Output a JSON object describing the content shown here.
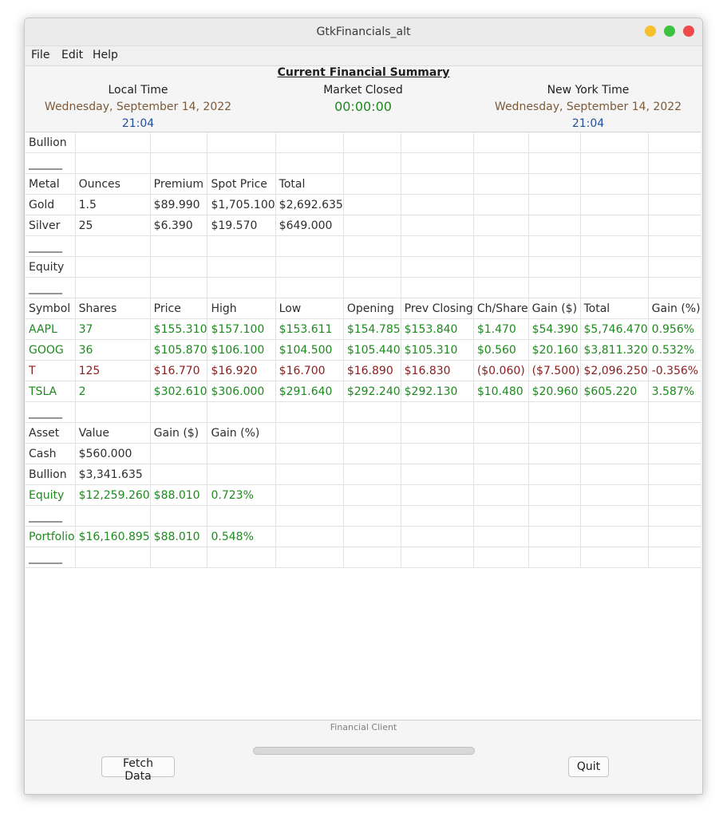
{
  "window": {
    "title": "GtkFinancials_alt"
  },
  "menu": {
    "file": "File",
    "edit": "Edit",
    "help": "Help"
  },
  "summary": {
    "title": "Current Financial Summary",
    "local": {
      "label": "Local Time",
      "date": "Wednesday, September 14, 2022",
      "time": "21:04"
    },
    "market": {
      "label": "Market Closed",
      "countdown": "00:00:00"
    },
    "newyork": {
      "label": "New York Time",
      "date": "Wednesday, September 14, 2022",
      "time": "21:04"
    }
  },
  "rows": [
    {
      "cls": "",
      "cells": [
        "Bullion"
      ]
    },
    {
      "cls": "",
      "cells": [
        "______"
      ]
    },
    {
      "cls": "",
      "cells": [
        "Metal",
        "Ounces",
        "Premium",
        "Spot Price",
        "Total"
      ]
    },
    {
      "cls": "",
      "cells": [
        "Gold",
        "1.5",
        "$89.990",
        "$1,705.100",
        "$2,692.635"
      ]
    },
    {
      "cls": "",
      "cells": [
        "Silver",
        "25",
        "$6.390",
        "$19.570",
        "$649.000"
      ]
    },
    {
      "cls": "",
      "cells": [
        "______"
      ]
    },
    {
      "cls": "",
      "cells": [
        "Equity"
      ]
    },
    {
      "cls": "",
      "cells": [
        "______"
      ]
    },
    {
      "cls": "",
      "cells": [
        "Symbol",
        "Shares",
        "Price",
        "High",
        "Low",
        "Opening",
        "Prev Closing",
        "Ch/Share",
        "Gain ($)",
        "Total",
        "Gain (%)"
      ]
    },
    {
      "cls": "pos",
      "cells": [
        "AAPL",
        "37",
        "$155.310",
        "$157.100",
        "$153.611",
        "$154.785",
        "$153.840",
        "$1.470",
        "$54.390",
        "$5,746.470",
        "0.956%"
      ]
    },
    {
      "cls": "pos",
      "cells": [
        "GOOG",
        "36",
        "$105.870",
        "$106.100",
        "$104.500",
        "$105.440",
        "$105.310",
        "$0.560",
        "$20.160",
        "$3,811.320",
        "0.532%"
      ]
    },
    {
      "cls": "neg",
      "cells": [
        "T",
        "125",
        "$16.770",
        "$16.920",
        "$16.700",
        "$16.890",
        "$16.830",
        "($0.060)",
        "($7.500)",
        "$2,096.250",
        "-0.356%"
      ]
    },
    {
      "cls": "pos",
      "cells": [
        "TSLA",
        "2",
        "$302.610",
        "$306.000",
        "$291.640",
        "$292.240",
        "$292.130",
        "$10.480",
        "$20.960",
        "$605.220",
        "3.587%"
      ]
    },
    {
      "cls": "",
      "cells": [
        "______"
      ]
    },
    {
      "cls": "",
      "cells": [
        "Asset",
        "Value",
        "Gain ($)",
        "Gain (%)"
      ]
    },
    {
      "cls": "",
      "cells": [
        "Cash",
        "$560.000"
      ]
    },
    {
      "cls": "",
      "cells": [
        "Bullion",
        "$3,341.635"
      ]
    },
    {
      "cls": "pos",
      "cells": [
        "Equity",
        "$12,259.260",
        "$88.010",
        "0.723%"
      ]
    },
    {
      "cls": "",
      "cells": [
        "______"
      ]
    },
    {
      "cls": "pos",
      "cells": [
        "Portfolio",
        "$16,160.895",
        "$88.010",
        "0.548%"
      ]
    },
    {
      "cls": "",
      "cells": [
        "______"
      ]
    }
  ],
  "status": {
    "label": "Financial Client",
    "progress": 0
  },
  "buttons": {
    "fetch": "Fetch Data",
    "quit": "Quit"
  },
  "colors": {
    "gain": "#1e8a1e",
    "loss": "#8a1e1e",
    "date": "#7b5a3a",
    "time": "#1f4fa0"
  }
}
